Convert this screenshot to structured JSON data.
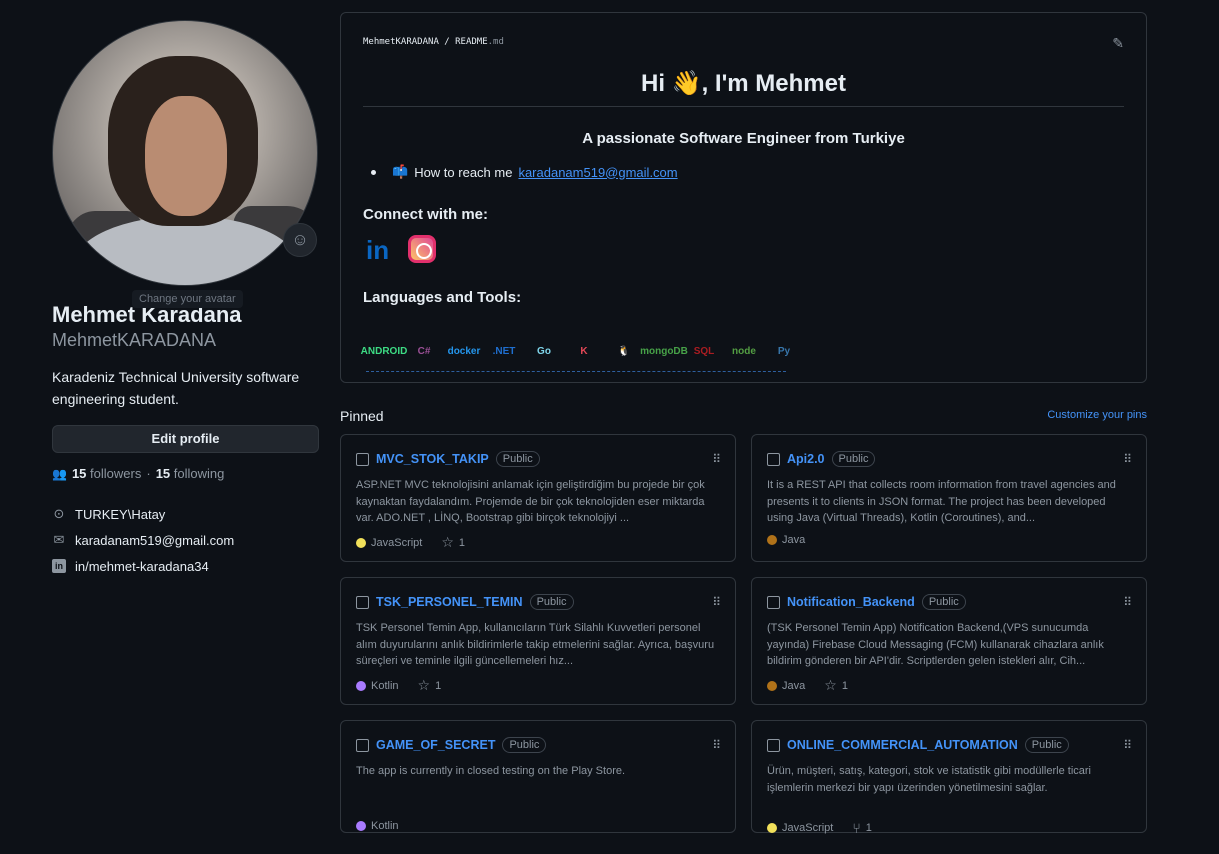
{
  "profile": {
    "change_avatar": "Change your avatar",
    "name": "Mehmet Karadana",
    "login": "MehmetKARADANA",
    "bio": "Karadeniz Technical University software engineering student.",
    "edit_label": "Edit profile",
    "followers_count": "15",
    "followers_label": "followers",
    "separator": "·",
    "following_count": "15",
    "following_label": "following",
    "location": "TURKEY\\Hatay",
    "email": "karadanam519@gmail.com",
    "linkedin": "in/mehmet-karadana34"
  },
  "readme": {
    "owner": "MehmetKARADANA",
    "slash": "/",
    "file": "README",
    "ext": ".md",
    "greeting": "Hi 👋, I'm Mehmet",
    "tagline": "A passionate Software Engineer from Turkiye",
    "reach_icon": "📫",
    "reach_text": "How to reach me",
    "reach_email": "karadanam519@gmail.com",
    "connect_heading": "Connect with me:",
    "languages_heading": "Languages and Tools:",
    "linkedin_glyph": "in",
    "tools": [
      {
        "name": "android",
        "label": "ANDROID",
        "color": "#3ddc84"
      },
      {
        "name": "csharp",
        "label": "C#",
        "color": "#9b4f96"
      },
      {
        "name": "docker",
        "label": "docker",
        "color": "#2496ed"
      },
      {
        "name": "dotnet",
        "label": ".NET",
        "color": "#1f6fd0"
      },
      {
        "name": "go",
        "label": "Go",
        "color": "#7fd5ea"
      },
      {
        "name": "kotlin",
        "label": "K",
        "color": "#e44857"
      },
      {
        "name": "linux",
        "label": "🐧",
        "color": "#fcc624"
      },
      {
        "name": "mongodb",
        "label": "mongoDB",
        "color": "#47a248"
      },
      {
        "name": "mssql",
        "label": "SQL",
        "color": "#a91d22"
      },
      {
        "name": "nodejs",
        "label": "node",
        "color": "#539e43"
      },
      {
        "name": "python",
        "label": "Py",
        "color": "#3776ab"
      }
    ]
  },
  "pinned": {
    "heading": "Pinned",
    "customize": "Customize your pins",
    "visibility": "Public",
    "cards": [
      {
        "name": "MVC_STOK_TAKIP",
        "desc": "ASP.NET MVC teknolojisini anlamak için geliştirdiğim bu projede bir çok kaynaktan faydalandım. Projemde de bir çok teknolojiden eser miktarda var. ADO.NET , LİNQ, Bootstrap gibi birçok teknolojiyi ...",
        "lang": "JavaScript",
        "lang_color": "#f1e05a",
        "stat_icon": "star-icon",
        "stat": "1"
      },
      {
        "name": "Api2.0",
        "desc": "It is a REST API that collects room information from travel agencies and presents it to clients in JSON format. The project has been developed using Java (Virtual Threads), Kotlin (Coroutines), and...",
        "lang": "Java",
        "lang_color": "#b07219",
        "stat_icon": "",
        "stat": ""
      },
      {
        "name": "TSK_PERSONEL_TEMIN",
        "desc": "TSK Personel Temin App, kullanıcıların Türk Silahlı Kuvvetleri personel alım duyurularını anlık bildirimlerle takip etmelerini sağlar. Ayrıca, başvuru süreçleri ve teminle ilgili güncellemeleri hız...",
        "lang": "Kotlin",
        "lang_color": "#a97bff",
        "stat_icon": "star-icon",
        "stat": "1"
      },
      {
        "name": "Notification_Backend",
        "desc": "(TSK Personel Temin App) Notification Backend,(VPS sunucumda yayında) Firebase Cloud Messaging (FCM) kullanarak cihazlara anlık bildirim gönderen bir API'dir. Scriptlerden gelen istekleri alır, Cih...",
        "lang": "Java",
        "lang_color": "#b07219",
        "stat_icon": "star-icon",
        "stat": "1"
      },
      {
        "name": "GAME_OF_SECRET",
        "desc": "The app is currently in closed testing on the Play Store.",
        "lang": "Kotlin",
        "lang_color": "#a97bff",
        "stat_icon": "",
        "stat": ""
      },
      {
        "name": "ONLINE_COMMERCIAL_AUTOMATION",
        "desc": "Ürün, müşteri, satış, kategori, stok ve istatistik gibi modüllerle ticari işlemlerin merkezi bir yapı üzerinden yönetilmesini sağlar.",
        "lang": "JavaScript",
        "lang_color": "#f1e05a",
        "stat_icon": "fork-icon",
        "stat": "1"
      }
    ]
  }
}
